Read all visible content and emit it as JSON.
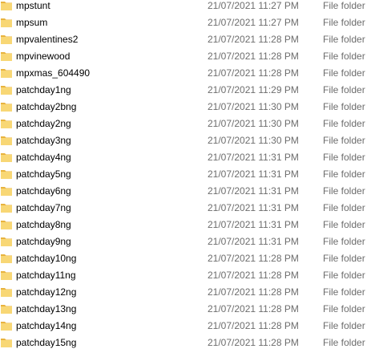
{
  "colors": {
    "folder_body": "#f8d775",
    "folder_tab": "#e8b33e",
    "name_text": "#000000",
    "meta_text": "#6d6d6d"
  },
  "icon": "folder-icon",
  "rows": [
    {
      "name": "mpstunt",
      "date": "21/07/2021 11:27 PM",
      "type": "File folder"
    },
    {
      "name": "mpsum",
      "date": "21/07/2021 11:27 PM",
      "type": "File folder"
    },
    {
      "name": "mpvalentines2",
      "date": "21/07/2021 11:28 PM",
      "type": "File folder"
    },
    {
      "name": "mpvinewood",
      "date": "21/07/2021 11:28 PM",
      "type": "File folder"
    },
    {
      "name": "mpxmas_604490",
      "date": "21/07/2021 11:28 PM",
      "type": "File folder"
    },
    {
      "name": "patchday1ng",
      "date": "21/07/2021 11:29 PM",
      "type": "File folder"
    },
    {
      "name": "patchday2bng",
      "date": "21/07/2021 11:30 PM",
      "type": "File folder"
    },
    {
      "name": "patchday2ng",
      "date": "21/07/2021 11:30 PM",
      "type": "File folder"
    },
    {
      "name": "patchday3ng",
      "date": "21/07/2021 11:30 PM",
      "type": "File folder"
    },
    {
      "name": "patchday4ng",
      "date": "21/07/2021 11:31 PM",
      "type": "File folder"
    },
    {
      "name": "patchday5ng",
      "date": "21/07/2021 11:31 PM",
      "type": "File folder"
    },
    {
      "name": "patchday6ng",
      "date": "21/07/2021 11:31 PM",
      "type": "File folder"
    },
    {
      "name": "patchday7ng",
      "date": "21/07/2021 11:31 PM",
      "type": "File folder"
    },
    {
      "name": "patchday8ng",
      "date": "21/07/2021 11:31 PM",
      "type": "File folder"
    },
    {
      "name": "patchday9ng",
      "date": "21/07/2021 11:31 PM",
      "type": "File folder"
    },
    {
      "name": "patchday10ng",
      "date": "21/07/2021 11:28 PM",
      "type": "File folder"
    },
    {
      "name": "patchday11ng",
      "date": "21/07/2021 11:28 PM",
      "type": "File folder"
    },
    {
      "name": "patchday12ng",
      "date": "21/07/2021 11:28 PM",
      "type": "File folder"
    },
    {
      "name": "patchday13ng",
      "date": "21/07/2021 11:28 PM",
      "type": "File folder"
    },
    {
      "name": "patchday14ng",
      "date": "21/07/2021 11:28 PM",
      "type": "File folder"
    },
    {
      "name": "patchday15ng",
      "date": "21/07/2021 11:28 PM",
      "type": "File folder"
    }
  ]
}
